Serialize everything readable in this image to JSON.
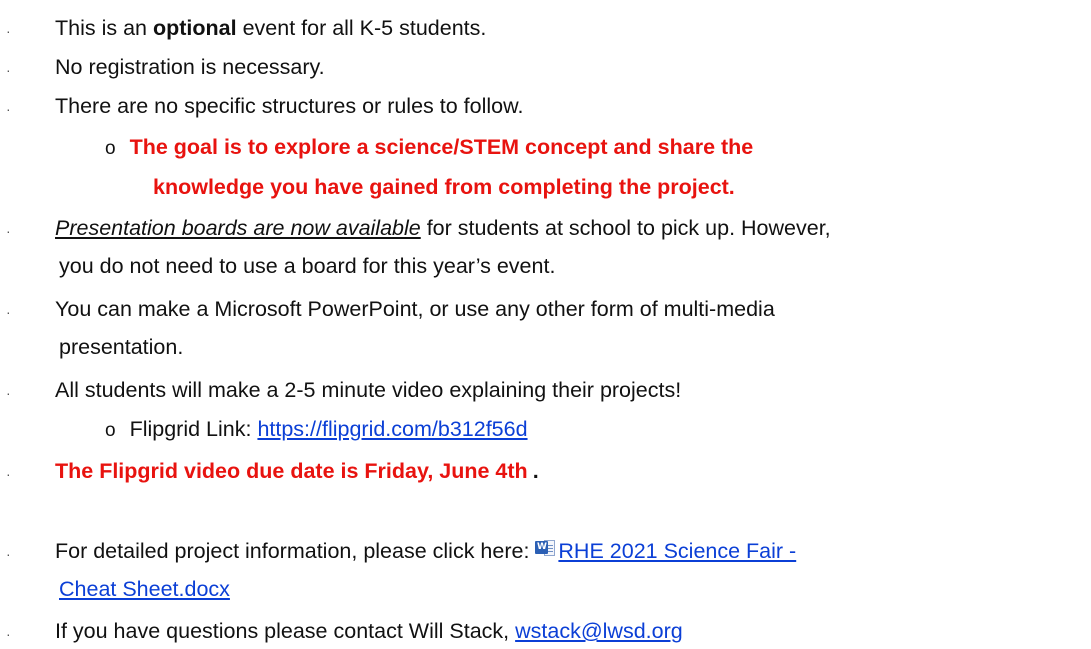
{
  "items": [
    {
      "pre": "This is an ",
      "bold": "optional",
      "post": " event for all K-5 students."
    },
    {
      "text": "No registration is necessary."
    },
    {
      "text": "There are no specific structures or rules to follow."
    },
    {
      "sub_marker": "o",
      "red_line1": "The goal is to explore a science/STEM concept and share the",
      "red_line2": "knowledge you have gained from completing the project."
    },
    {
      "italic": "Presentation boards are now available",
      "post": " for students at school to pick up. However,",
      "line2": "you do not need to use a board for this year’s event."
    },
    {
      "line1": "You can make a Microsoft PowerPoint, or use any other form of multi-media",
      "line2": "presentation."
    },
    {
      "text": "All students will make a 2-5 minute video explaining their projects!"
    },
    {
      "sub_marker": "o",
      "label": "Flipgrid Link: ",
      "link": "https://flipgrid.com/b312f56d"
    },
    {
      "red": "The Flipgrid video due date is Friday, June 4th",
      "dot": "."
    },
    {
      "pre": "For detailed project information, please click here: ",
      "link1": "RHE 2021 Science Fair -",
      "link2": "Cheat Sheet.docx",
      "icon": "word-document-icon"
    },
    {
      "pre": "If you have questions please contact Will Stack, ",
      "email": "wstack@lwsd.org"
    }
  ],
  "bullet_char": "·",
  "colors": {
    "red": "#e8130f",
    "link": "#0b3fd6",
    "text": "#111111"
  }
}
